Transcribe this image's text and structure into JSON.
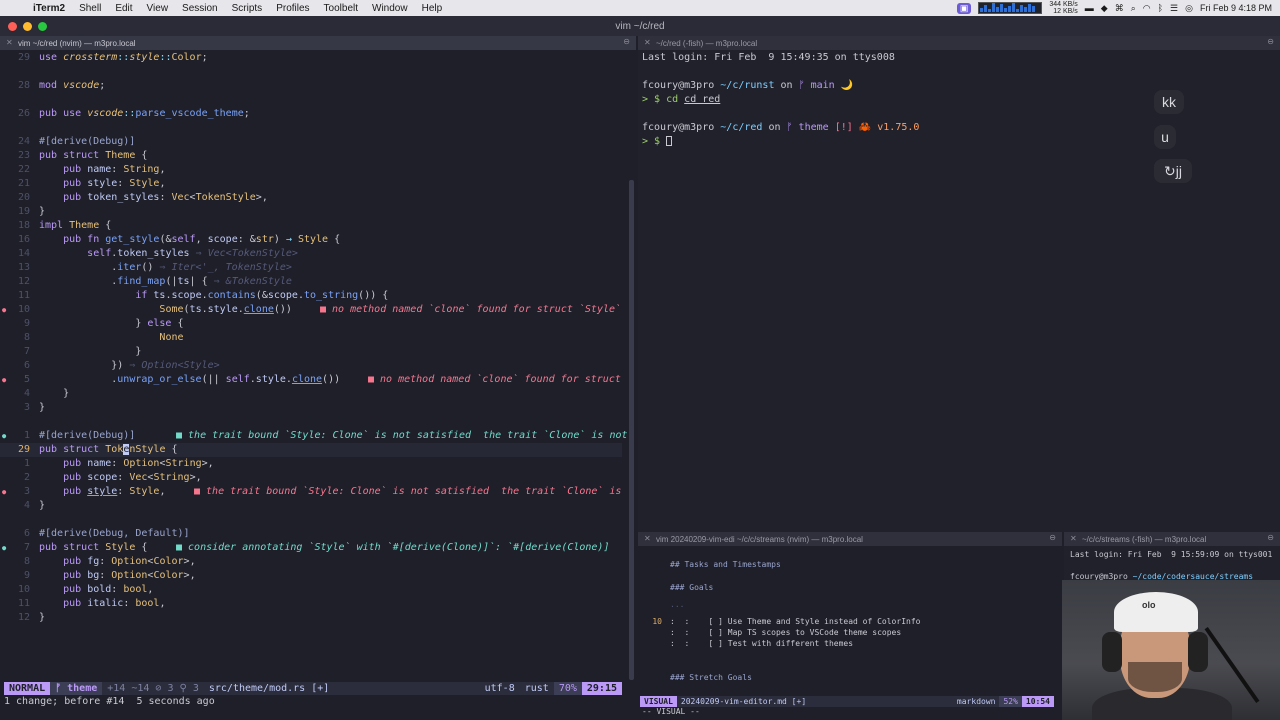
{
  "menubar": {
    "app": "iTerm2",
    "items": [
      "Shell",
      "Edit",
      "View",
      "Session",
      "Scripts",
      "Profiles",
      "Toolbelt",
      "Window",
      "Help"
    ],
    "net_up": "344 KB/s",
    "net_down": "12 KB/s",
    "clock": "Fri Feb 9  4:18 PM"
  },
  "window": {
    "title": "vim ~/c/red"
  },
  "panes": {
    "left_header": "vim ~/c/red (nvim) — m3pro.local",
    "right_header": "~/c/red (-fish) — m3pro.local",
    "bottom_left_header": "vim 20240209-vim-edi ~/c/c/streams (nvim) — m3pro.local",
    "bottom_right_header": "~/c/c/streams (-fish) — m3pro.local"
  },
  "editor": {
    "diag_no_clone_1": "■ no method named `clone` found for struct `Style`",
    "diag_no_clone_2": "■ no method named `clone` found for struct",
    "diag_trait_1": "■ the trait bound `Style: Clone` is not satisfied  the trait `Clone` is not",
    "diag_trait_2": "■ the trait bound `Style: Clone` is not satisfied  the trait `Clone` is",
    "diag_consider": "■ consider annotating `Style` with `#[derive(Clone)]`: `#[derive(Clone)]",
    "cursor_line_number": "29"
  },
  "statusline": {
    "mode": "NORMAL",
    "branch": "ᚠ theme",
    "diff": "+14 ~14 ⊘ 3 ⚲ 3",
    "file": "src/theme/mod.rs [+]",
    "encoding": "utf-8",
    "filetype": "rust",
    "percent": "70%",
    "position": "29:15",
    "message": "1 change; before #14  5 seconds ago"
  },
  "terminal_right": {
    "last_login": "Last login: Fri Feb  9 15:49:35 on ttys008",
    "prompt1_user": "fcoury@m3pro",
    "prompt1_path": "~/c/runst",
    "prompt1_branch": "ᚠ main",
    "prompt1_moon": "🌙",
    "command1": "cd red",
    "prompt2_user": "fcoury@m3pro",
    "prompt2_path": "~/c/red",
    "prompt2_branch": "ᚠ theme",
    "prompt2_status": "[!]",
    "prompt2_crab": "🦀",
    "prompt2_version": "v1.75.0",
    "key_chips": [
      "kk",
      "u",
      "↻jj"
    ]
  },
  "markdown": {
    "lines": [
      {
        "n": "",
        "t": "## Tasks and Timestamps"
      },
      {
        "n": "",
        "t": "### Goals"
      },
      {
        "n": "",
        "t": "..."
      },
      {
        "n": "10",
        "t": ":  :    [ ] Use Theme and Style instead of ColorInfo"
      },
      {
        "n": "",
        "t": ":  :    [ ] Map TS scopes to VSCode theme scopes"
      },
      {
        "n": "",
        "t": ":  :    [ ] Test with different themes"
      },
      {
        "n": "",
        "t": "### Stretch Goals"
      }
    ],
    "status_mode": "VISUAL",
    "status_file": "20240209-vim-editor.md [+]",
    "status_ft": "markdown",
    "status_pct": "52%",
    "status_pos": "10:54",
    "cmd": "-- VISUAL --"
  },
  "terminal_br": {
    "last_login": "Last login: Fri Feb  9 15:59:09 on ttys001",
    "prompt_user": "fcoury@m3pro",
    "prompt_path": "~/code/codersauce/streams",
    "prompt_symbol": "> $"
  },
  "webcam": {
    "cap_logo": "olo"
  }
}
